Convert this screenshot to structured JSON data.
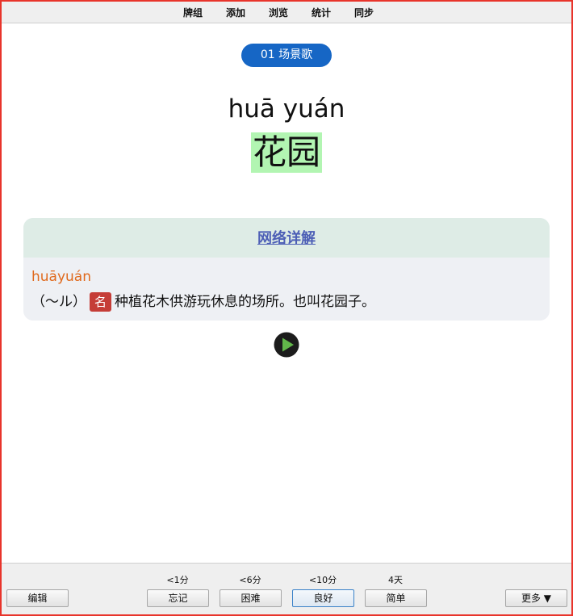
{
  "menu": {
    "items": [
      "牌组",
      "添加",
      "浏览",
      "统计",
      "同步"
    ]
  },
  "deck_label": "01 场景歌",
  "word": {
    "pinyin": "huā yuán",
    "hanzi": "花园"
  },
  "definition_card": {
    "header_link": "网络详解",
    "pinyin": "huāyuán",
    "prefix": "（～ル）",
    "pos_badge": "名",
    "text": "种植花木供游玩休息的场所。也叫花园子。"
  },
  "play_button": {
    "icon": "play-icon"
  },
  "bottom": {
    "edit_label": "编辑",
    "answers": [
      {
        "label": "忘记",
        "hint": "<1分"
      },
      {
        "label": "困难",
        "hint": "<6分"
      },
      {
        "label": "良好",
        "hint": "<10分"
      },
      {
        "label": "简单",
        "hint": "4天"
      }
    ],
    "more_label": "更多 ▼"
  },
  "colors": {
    "frame": "#e8342b",
    "pill": "#1666c5",
    "highlight": "#b2f5b2",
    "pinyin_orange": "#e06a1d",
    "badge_red": "#c53d37",
    "link_blue": "#4d5fb6"
  }
}
